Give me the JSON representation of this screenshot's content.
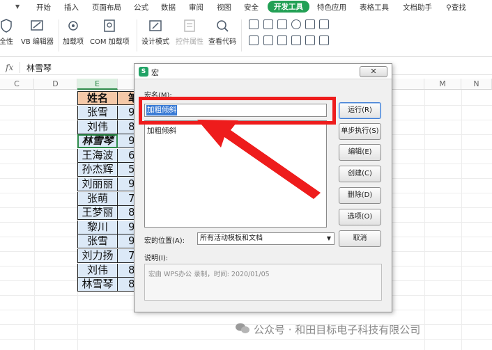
{
  "ribbon": {
    "tabs": [
      "开始",
      "插入",
      "页面布局",
      "公式",
      "数据",
      "审阅",
      "视图",
      "安全",
      "开发工具",
      "特色应用",
      "表格工具",
      "文档助手"
    ],
    "active_tab": "开发工具",
    "search_label": "查找",
    "buttons": {
      "safety": "全性",
      "vb_editor": "VB 编辑器",
      "addins": "加载项",
      "com_addins": "COM 加载项",
      "design_mode": "设计模式",
      "control_props": "控件属性",
      "view_code": "查看代码"
    }
  },
  "formula_bar": {
    "fx_label": "fx",
    "value": "林雪琴"
  },
  "sheet": {
    "columns": [
      "C",
      "D",
      "E",
      "M",
      "N"
    ],
    "selected_column": "E",
    "header": [
      "姓名",
      "笔"
    ],
    "rows": [
      [
        "张雪",
        "9"
      ],
      [
        "刘伟",
        "8"
      ],
      [
        "林雪琴",
        "9"
      ],
      [
        "王海波",
        "6"
      ],
      [
        "孙杰辉",
        "5"
      ],
      [
        "刘丽丽",
        "9"
      ],
      [
        "张萌",
        "7"
      ],
      [
        "王梦丽",
        "8"
      ],
      [
        "黎川",
        "9"
      ],
      [
        "张雪",
        "9"
      ],
      [
        "刘力扬",
        "7"
      ],
      [
        "刘伟",
        "8"
      ],
      [
        "林雪琴",
        "8"
      ]
    ]
  },
  "dialog": {
    "title": "宏",
    "close_label": "✕",
    "macro_name_label": "宏名(M):",
    "macro_name_value": "加粗倾斜",
    "macro_list": [
      "加粗倾斜"
    ],
    "buttons": {
      "run": "运行(R)",
      "step": "单步执行(S)",
      "edit": "编辑(E)",
      "create": "创建(C)",
      "delete": "删除(D)",
      "options": "选项(O)",
      "cancel": "取消"
    },
    "location_label": "宏的位置(A):",
    "location_value": "所有活动模板和文档",
    "description_label": "说明(I):",
    "description_text": "宏由 WPS办公 录制，时间: 2020/01/05"
  },
  "watermark": "公众号 · 和田目标电子科技有限公司",
  "colors": {
    "accent": "#22a055",
    "annotation": "#ee1c1c",
    "header_fill": "#f5c9a8",
    "data_fill": "#dce9f7"
  }
}
